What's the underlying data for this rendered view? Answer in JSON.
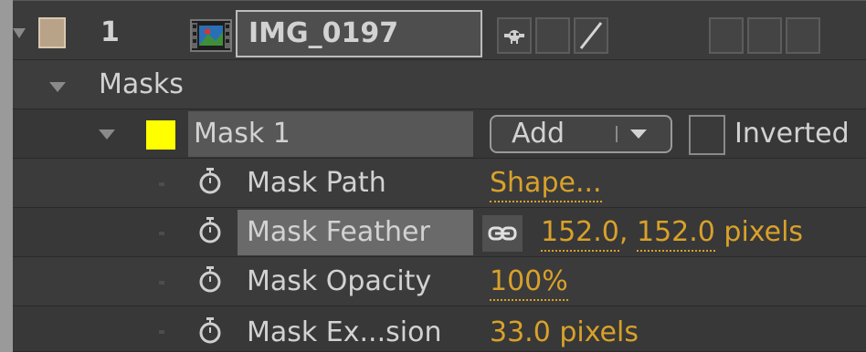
{
  "layer": {
    "number": "1",
    "name": "IMG_0197",
    "label_color": "#b8a288"
  },
  "masks_group": {
    "label": "Masks"
  },
  "mask": {
    "name": "Mask 1",
    "color": "#ffff00",
    "mode": "Add",
    "inverted_label": "Inverted",
    "inverted": false
  },
  "properties": [
    {
      "label": "Mask Path",
      "value": "Shape..."
    },
    {
      "label": "Mask Feather",
      "value_x": "152.0",
      "value_sep": ",",
      "value_y": "152.0",
      "unit": "pixels"
    },
    {
      "label": "Mask Opacity",
      "value": "100%"
    },
    {
      "label": "Mask Ex...sion",
      "value": "33.0",
      "unit": "pixels"
    }
  ],
  "colors": {
    "value_gold": "#d9a12a",
    "text": "#d2d2d2",
    "panel_bg": "#3b3b3b"
  },
  "icons": {
    "twirl": "triangle-down",
    "stopwatch": "stopwatch-icon",
    "footage": "footage-icon",
    "link": "constrain-proportions-icon",
    "shy": "shy-icon",
    "quality": "quality-slash-icon"
  }
}
